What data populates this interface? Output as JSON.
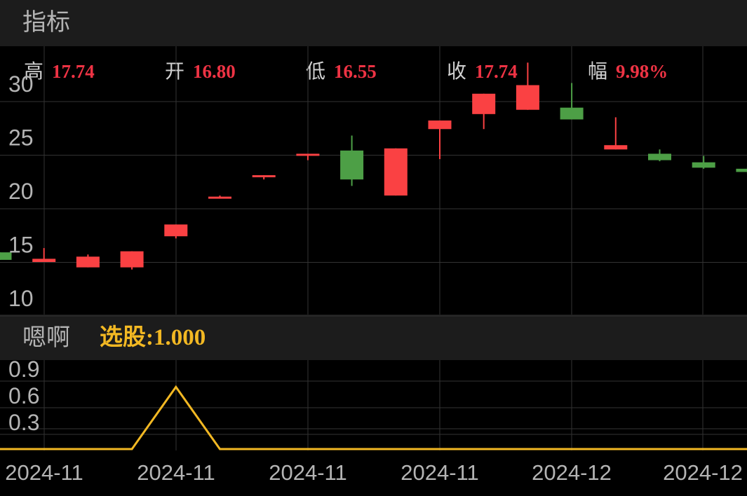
{
  "panel": {
    "title": "指标"
  },
  "ohlc": [
    {
      "label": "高",
      "value": "17.74"
    },
    {
      "label": "开",
      "value": "16.80"
    },
    {
      "label": "低",
      "value": "16.55"
    },
    {
      "label": "收",
      "value": "17.74"
    },
    {
      "label": "幅",
      "value": "9.98%"
    }
  ],
  "indicator": {
    "name": "嗯啊",
    "readout": "选股:1.000"
  },
  "colors": {
    "up": "#fa4143",
    "down": "#4d9f46",
    "indicator_line": "#f2b823",
    "grid": "#333333"
  },
  "chart_data": [
    {
      "type": "candlestick",
      "ylim": [
        10,
        30
      ],
      "yticks": [
        "10",
        "15",
        "20",
        "25",
        "30"
      ],
      "xticks": [
        "2024-11",
        "2024-11",
        "2024-11",
        "2024-11",
        "2024-12",
        "2024-12"
      ],
      "candles": [
        {
          "open": 14.3,
          "close": 13.6,
          "high": 14.3,
          "low": 13.6
        },
        {
          "open": 13.4,
          "close": 13.7,
          "high": 14.7,
          "low": 13.4
        },
        {
          "open": 12.9,
          "close": 13.9,
          "high": 14.1,
          "low": 12.9
        },
        {
          "open": 12.9,
          "close": 14.4,
          "high": 14.4,
          "low": 12.7
        },
        {
          "open": 15.8,
          "close": 16.9,
          "high": 16.9,
          "low": 15.6
        },
        {
          "open": 19.5,
          "close": 19.5,
          "high": 19.6,
          "low": 19.4
        },
        {
          "open": 21.4,
          "close": 21.5,
          "high": 21.5,
          "low": 21.1
        },
        {
          "open": 23.4,
          "close": 23.5,
          "high": 23.5,
          "low": 22.9
        },
        {
          "open": 23.8,
          "close": 21.1,
          "high": 25.2,
          "low": 20.5
        },
        {
          "open": 19.6,
          "close": 24.0,
          "high": 24.0,
          "low": 19.6
        },
        {
          "open": 25.8,
          "close": 26.6,
          "high": 26.6,
          "low": 23.0
        },
        {
          "open": 27.2,
          "close": 29.1,
          "high": 29.1,
          "low": 25.8
        },
        {
          "open": 27.6,
          "close": 29.9,
          "high": 32.0,
          "low": 27.6
        },
        {
          "open": 27.8,
          "close": 26.7,
          "high": 30.1,
          "low": 26.7
        },
        {
          "open": 23.9,
          "close": 24.3,
          "high": 26.9,
          "low": 23.9
        },
        {
          "open": 23.5,
          "close": 22.9,
          "high": 23.9,
          "low": 22.8
        },
        {
          "open": 22.7,
          "close": 22.2,
          "high": 23.3,
          "low": 22.1
        },
        {
          "open": 22.1,
          "close": 21.8,
          "high": 22.3,
          "low": 21.6
        }
      ]
    },
    {
      "type": "line",
      "name": "选股",
      "ylim": [
        0,
        0.9
      ],
      "yticks": [
        "0.3",
        "0.6",
        "0.9"
      ],
      "values": [
        0,
        0,
        0,
        0,
        0.7,
        0,
        0,
        0,
        0,
        0,
        0,
        0,
        0,
        0,
        0,
        0,
        0,
        0
      ]
    }
  ]
}
